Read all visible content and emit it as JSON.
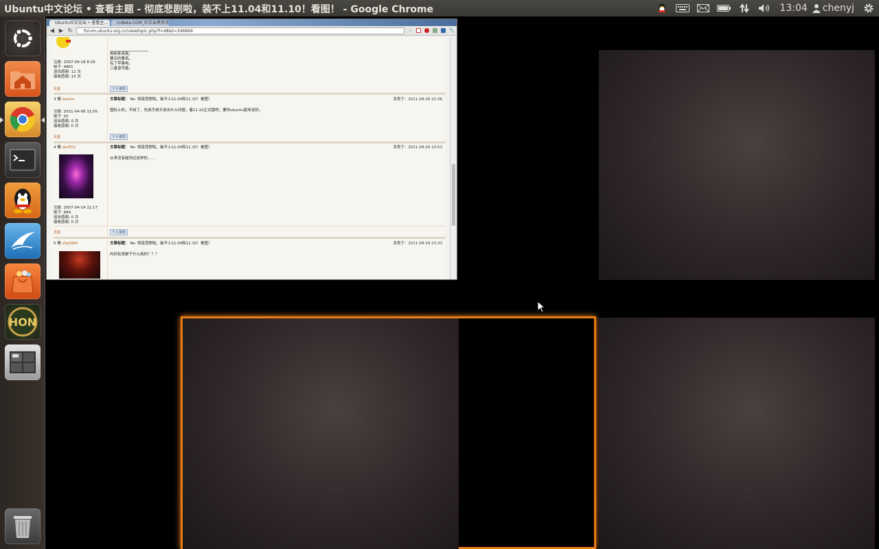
{
  "topbar": {
    "title": "Ubuntu中文论坛 • 查看主题 - 彻底悲剧啦，装不上11.04和11.10！看图！ - Google Chrome",
    "time": "13:04",
    "user": "chenyj"
  },
  "launcher": {
    "items": [
      "dash-home",
      "files",
      "chrome",
      "terminal",
      "qq",
      "flying-app",
      "software-center",
      "hon-game",
      "workspace-switcher",
      "trash"
    ]
  },
  "browser": {
    "tabs": [
      "Ubuntu中文论坛 • 查看主…",
      "cnBeta.COM_中文业界资讯…"
    ],
    "url": "forum.ubuntu.org.cn/viewtopic.php?f=48&t=346849",
    "posts": [
      {
        "floor": "",
        "user": "",
        "reg": "注册: 2007-09-18 8:29",
        "posts": "帖子: 4861",
        "sent": "送出感谢: 12 次",
        "recv": "接收感谢: 15 次",
        "lines": [
          "再刷来来爽。",
          "要买的要低。",
          "有了苹果电，",
          "二者皆可能。"
        ],
        "top": "页首",
        "pm": "个人资料"
      },
      {
        "floor": "3 楼",
        "user": "kevino",
        "subject_label": "文章标题：",
        "subject": "Re: 彻底悲剧啦，装不上11.04和11.10！看图！",
        "date": "发表于：2011-09-28 22:36",
        "reg": "注册: 2011-04-06 11:05",
        "posts": "帖子: 50",
        "sent": "送出感谢: 0 次",
        "recv": "接收感谢: 0 次",
        "body": "图标上的，不知了，先用手册文说出什么问题，着11.10正式版吧，要你ubuntu版来说好。",
        "top": "页首",
        "pm": "个人资料"
      },
      {
        "floor": "4 楼",
        "user": "dwl301",
        "subject_label": "文章标题：",
        "subject": "Re: 彻底悲剧啦，装不上11.04和11.10！看图！",
        "date": "发表于：2011-09-29 10:53",
        "reg": "注册: 2007-04-14 11:17",
        "posts": "帖子: 684",
        "sent": "送出感谢: 0 次",
        "recv": "接收感谢: 0 次",
        "body": "从来没有碰到过这样的……",
        "top": "页首",
        "pm": "个人资料"
      },
      {
        "floor": "5 楼",
        "user": "yfq1984",
        "subject_label": "文章标题：",
        "subject": "Re: 彻底悲剧啦，装不上11.04和11.10！看图！",
        "date": "发表于：2011-09-29 23:33",
        "body": "内存检测是干什么用的？？？"
      }
    ]
  },
  "colors": {
    "accent": "#e87c17",
    "panel": "#3c3b37"
  }
}
